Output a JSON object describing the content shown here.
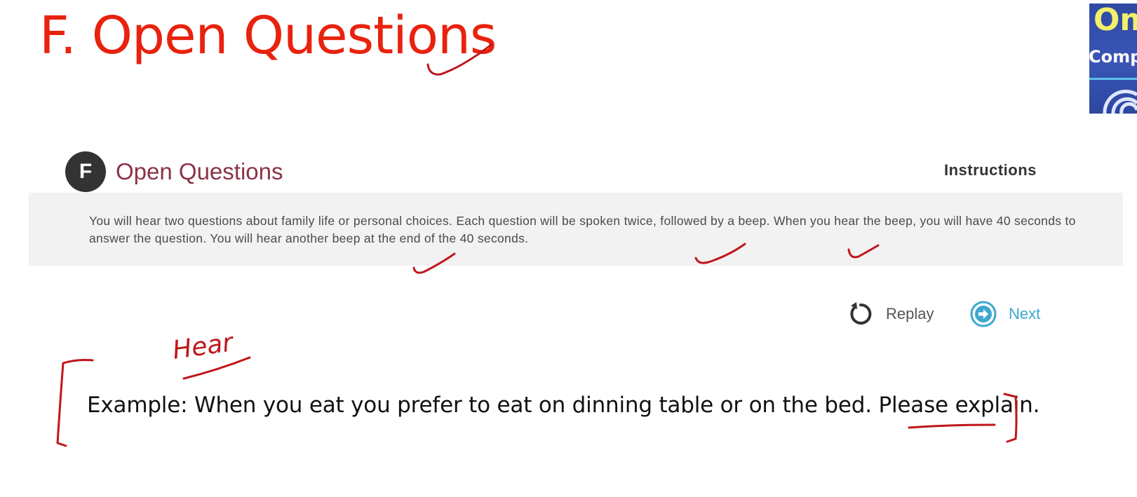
{
  "slide": {
    "title": "F. Open Questions"
  },
  "logo": {
    "top_text": "Om",
    "mid_text": "Compi"
  },
  "panel": {
    "badge_letter": "F",
    "section_title": "Open Questions",
    "instructions_label": "Instructions",
    "instructions_text": "You will hear two questions about family life or personal choices. Each question will be spoken twice, followed by a beep. When you hear the beep, you will have 40 seconds to answer the question. You will hear another beep at the end of the 40 seconds."
  },
  "controls": {
    "replay_label": "Replay",
    "replay_icon": "replay-arrow-icon",
    "next_label": "Next",
    "next_icon": "next-arrow-circle-icon"
  },
  "annotation": {
    "handwritten_note": "Hear",
    "example_text": "Example: When you eat you prefer to eat on dinning table or on the bed. Please explain.",
    "ink_color": "#c0161a"
  },
  "colors": {
    "title_red": "#e8220e",
    "section_title": "#8a3347",
    "next_blue": "#3fa7cf",
    "logo_blue": "#2f4aa3",
    "logo_yellow": "#f3f06a"
  }
}
